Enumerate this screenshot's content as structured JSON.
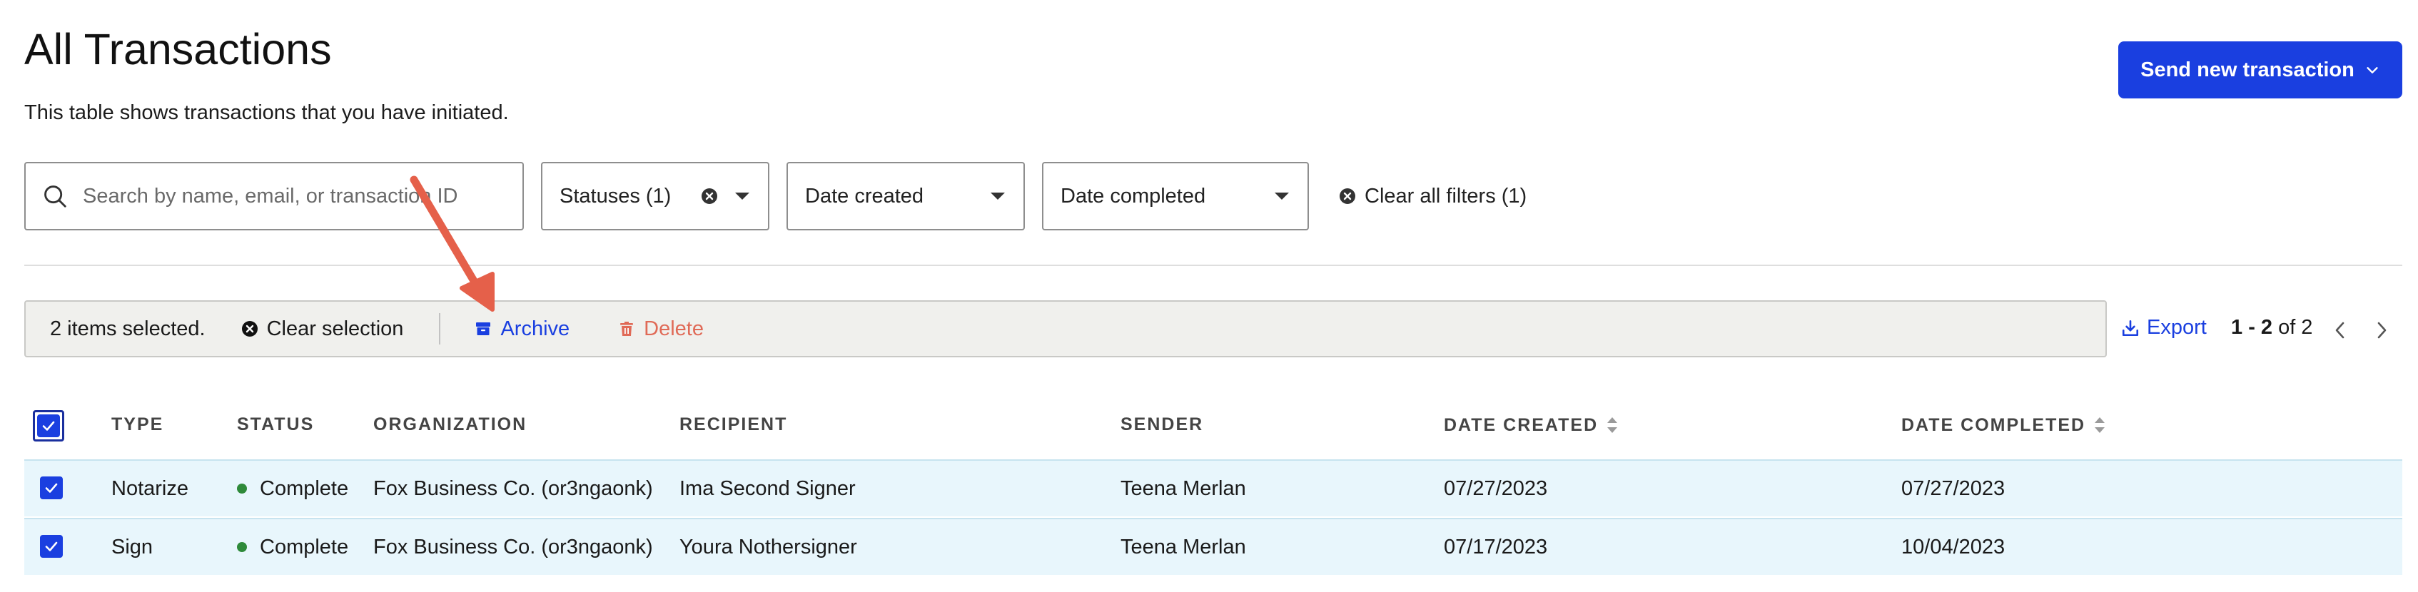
{
  "header": {
    "title": "All Transactions",
    "subtitle": "This table shows transactions that you have initiated.",
    "send_button_label": "Send new transaction"
  },
  "filters": {
    "search_placeholder": "Search by name, email, or transaction ID",
    "search_value": "",
    "statuses_label": "Statuses (1)",
    "date_created_label": "Date created",
    "date_completed_label": "Date completed",
    "clear_all_label": "Clear all filters (1)"
  },
  "bulk_actions": {
    "selected_label": "2 items selected.",
    "clear_selection_label": "Clear selection",
    "archive_label": "Archive",
    "delete_label": "Delete"
  },
  "toolbar": {
    "export_label": "Export",
    "page_range_start": "1",
    "page_range_sep": " - ",
    "page_range_end": "2",
    "page_of": "of 2"
  },
  "table": {
    "columns": [
      "TYPE",
      "STATUS",
      "ORGANIZATION",
      "RECIPIENT",
      "SENDER",
      "DATE CREATED",
      "DATE COMPLETED"
    ],
    "rows": [
      {
        "type": "Notarize",
        "status": "Complete",
        "organization": "Fox Business Co. (or3ngaonk)",
        "recipient": "Ima Second Signer",
        "sender": "Teena Merlan",
        "date_created": "07/27/2023",
        "date_completed": "07/27/2023"
      },
      {
        "type": "Sign",
        "status": "Complete",
        "organization": "Fox Business Co. (or3ngaonk)",
        "recipient": "Youra Nothersigner",
        "sender": "Teena Merlan",
        "date_created": "07/17/2023",
        "date_completed": "10/04/2023"
      }
    ]
  },
  "colors": {
    "primary": "#1a3fe0",
    "delete": "#e06a57",
    "status_complete": "#2e8a3a",
    "selected_row": "#e8f6fc",
    "annotation_arrow": "#e5604a"
  },
  "icons": [
    "search-icon",
    "chevron-down-icon",
    "x-circle-icon",
    "archive-icon",
    "trash-icon",
    "export-icon",
    "sort-icon",
    "check-icon",
    "chevron-left-icon",
    "chevron-right-icon"
  ]
}
